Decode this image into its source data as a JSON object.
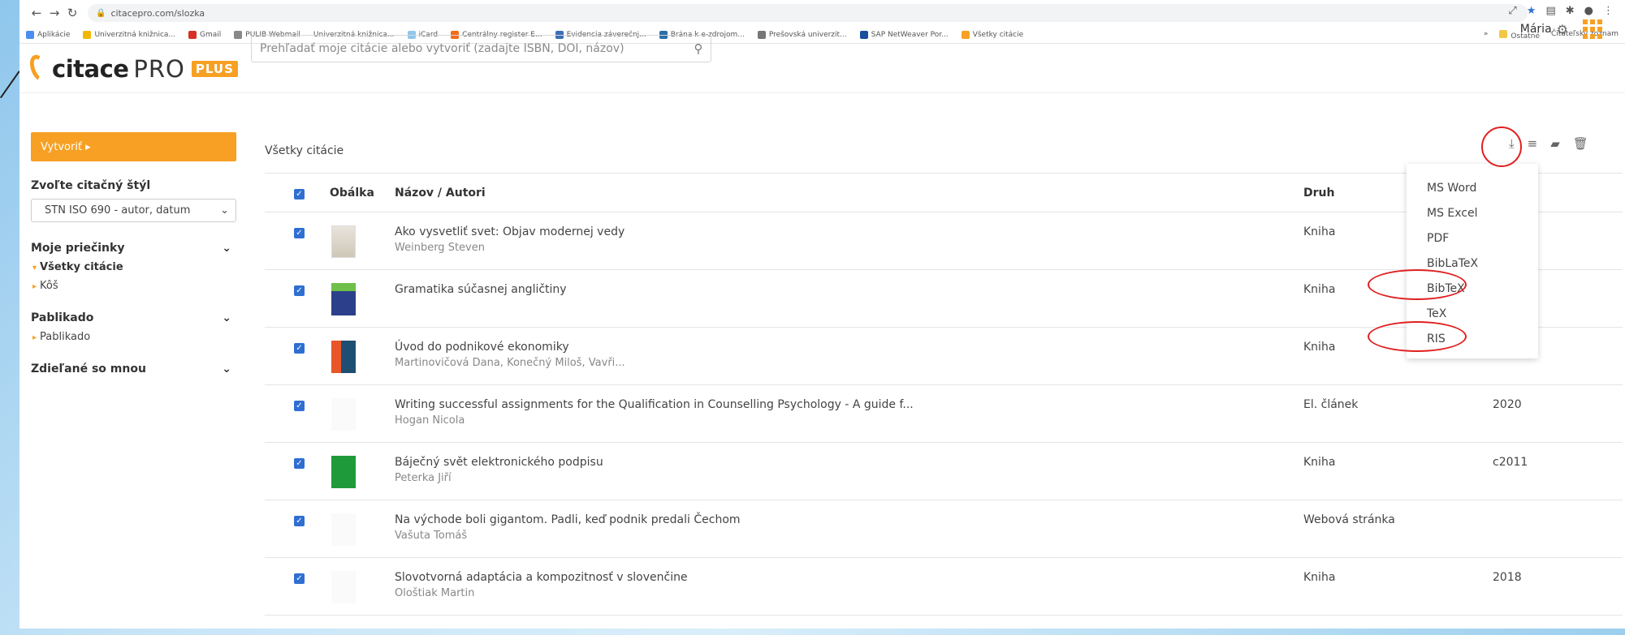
{
  "browser": {
    "url": "citacepro.com/slozka",
    "bookmarks": [
      "Aplikácie",
      "Univerzitná knižnica...",
      "Gmail",
      "PULIB Webmail",
      "Univerzitná knižnica...",
      "iCard",
      "Centrálny register E...",
      "Evidencia záverečnj...",
      "Brána k e-zdrojom...",
      "Prešovská univerzit...",
      "SAP NetWeaver Por...",
      "Všetky citácie"
    ],
    "bookmarks_right": [
      "»",
      "Ostatné",
      "Čitateľský zoznam"
    ]
  },
  "header": {
    "logo_citace": "citace",
    "logo_pro": "PRO",
    "logo_plus": "PLUS",
    "search_placeholder": "Prehľadať moje citácie alebo vytvoriť (zadajte ISBN, DOI, názov)",
    "user_name": "Mária"
  },
  "sidebar": {
    "create_label": "Vytvoriť ▸",
    "style_label": "Zvoľte citačný štýl",
    "style_value": "STN ISO 690 - autor, datum",
    "folders_label": "Moje priečinky",
    "folders": [
      "Všetky citácie",
      "Kôš"
    ],
    "published_label": "Pablikado",
    "published_items": [
      "Pablikado"
    ],
    "shared_label": "Zdieľané so mnou"
  },
  "main": {
    "section_title": "Všetky citácie",
    "columns": {
      "cover": "Obálka",
      "title": "Názov / Autori",
      "kind": "Druh"
    },
    "rows": [
      {
        "title": "Ako vysvetliť svet: Objav modernej vedy",
        "author": "Weinberg Steven",
        "kind": "Kniha",
        "year": ""
      },
      {
        "title": "Gramatika súčasnej angličtiny",
        "author": "",
        "kind": "Kniha",
        "year": ""
      },
      {
        "title": "Úvod do podnikové ekonomiky",
        "author": "Martinovičová Dana, Konečný Miloš, Vavři...",
        "kind": "Kniha",
        "year": ""
      },
      {
        "title": "Writing successful assignments for the Qualification in Counselling Psychology - A guide f...",
        "author": "Hogan Nicola",
        "kind": "El. článek",
        "year": "2020"
      },
      {
        "title": "Báječný svět elektronického podpisu",
        "author": "Peterka Jiří",
        "kind": "Kniha",
        "year": "c2011"
      },
      {
        "title": "Na východe boli gigantom. Padli, keď podnik predali Čechom",
        "author": "Vašuta Tomáš",
        "kind": "Webová stránka",
        "year": ""
      },
      {
        "title": "Slovotvorná adaptácia a kompozitnosť v slovenčine",
        "author": "Ološtiak Martin",
        "kind": "Kniha",
        "year": "2018"
      }
    ]
  },
  "export_menu": {
    "items": [
      "MS Word",
      "MS Excel",
      "PDF",
      "BibLaTeX",
      "BibTeX",
      "TeX",
      "RIS"
    ]
  },
  "colors": {
    "accent": "#f7a023",
    "checkbox": "#2f6fd1",
    "annotation": "#e01f1f"
  }
}
